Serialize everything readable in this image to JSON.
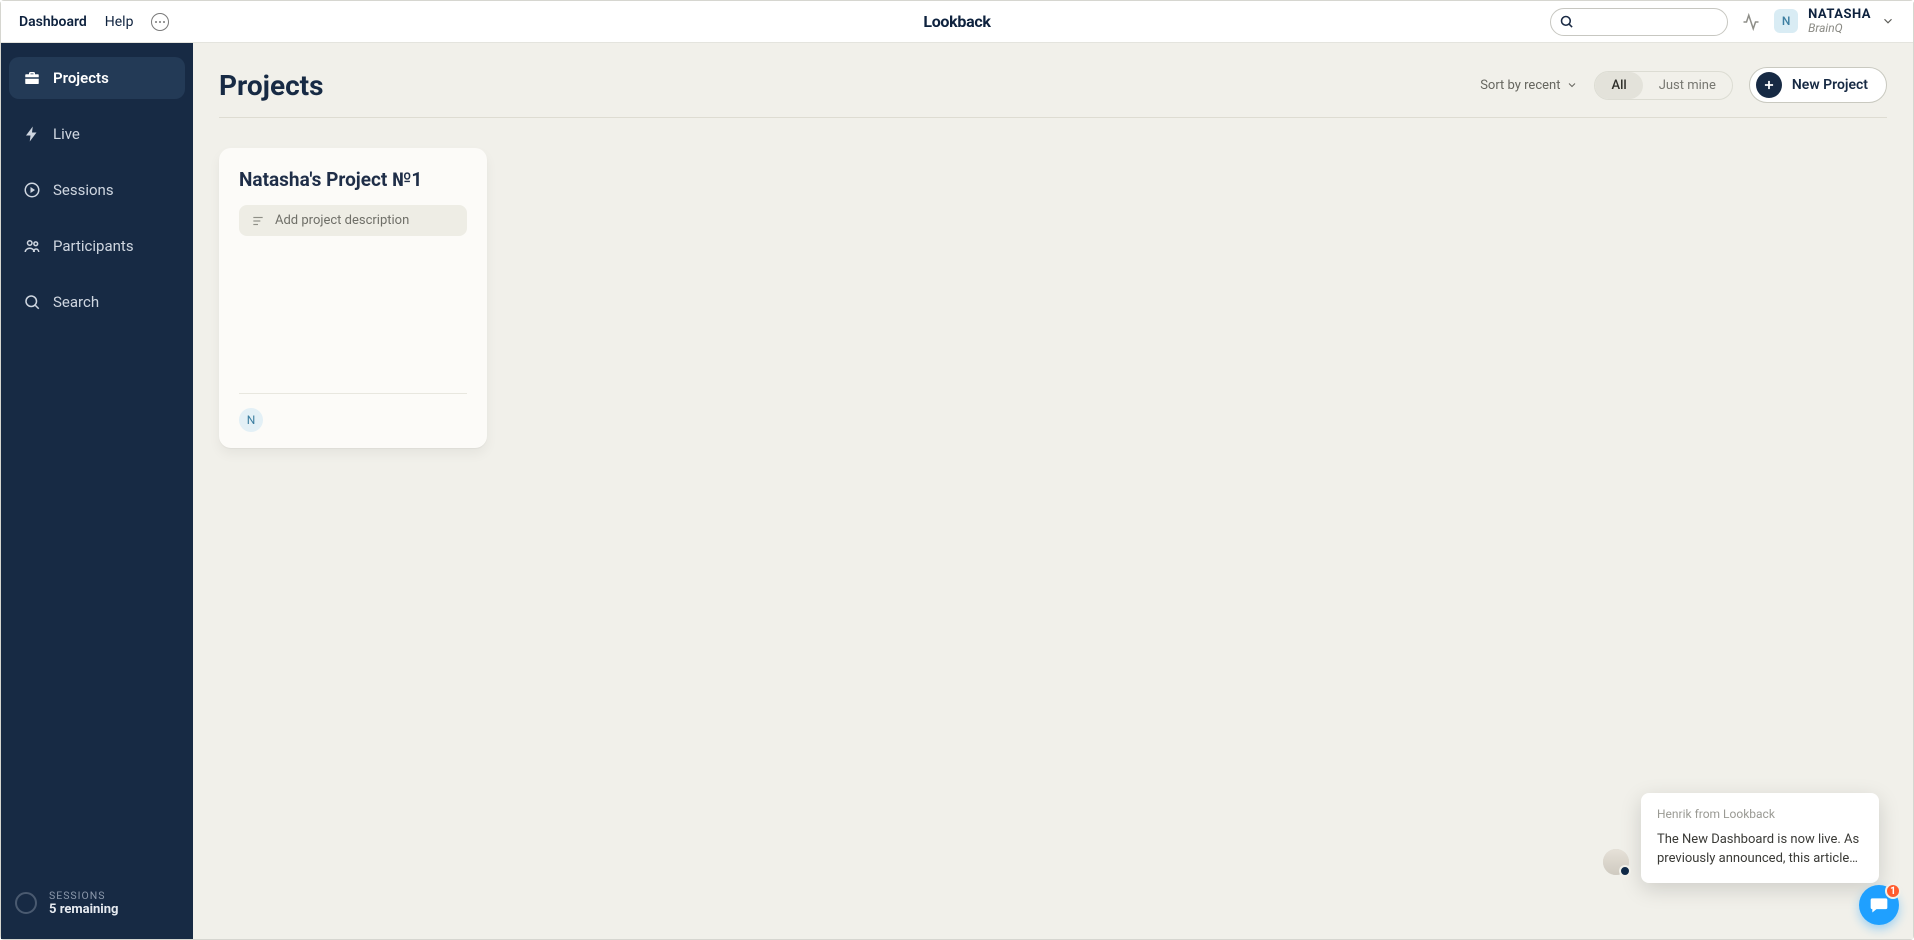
{
  "topbar": {
    "dashboard": "Dashboard",
    "help": "Help",
    "logo": "Lookback",
    "search_placeholder": "",
    "user": {
      "initial": "N",
      "name": "NATASHA",
      "org": "BrainQ"
    }
  },
  "sidebar": {
    "items": [
      {
        "label": "Projects"
      },
      {
        "label": "Live"
      },
      {
        "label": "Sessions"
      },
      {
        "label": "Participants"
      },
      {
        "label": "Search"
      }
    ],
    "footer": {
      "label": "SESSIONS",
      "value": "5 remaining"
    }
  },
  "main": {
    "title": "Projects",
    "sort": "Sort by recent",
    "filter": {
      "all": "All",
      "mine": "Just mine"
    },
    "new_project": "New Project"
  },
  "cards": [
    {
      "title": "Natasha's Project №1",
      "desc_placeholder": "Add project description",
      "member_initial": "N"
    }
  ],
  "notification": {
    "from": "Henrik from Lookback",
    "body": "The New Dashboard is now live. As previously announced, this article…"
  },
  "chat": {
    "badge": "1"
  }
}
